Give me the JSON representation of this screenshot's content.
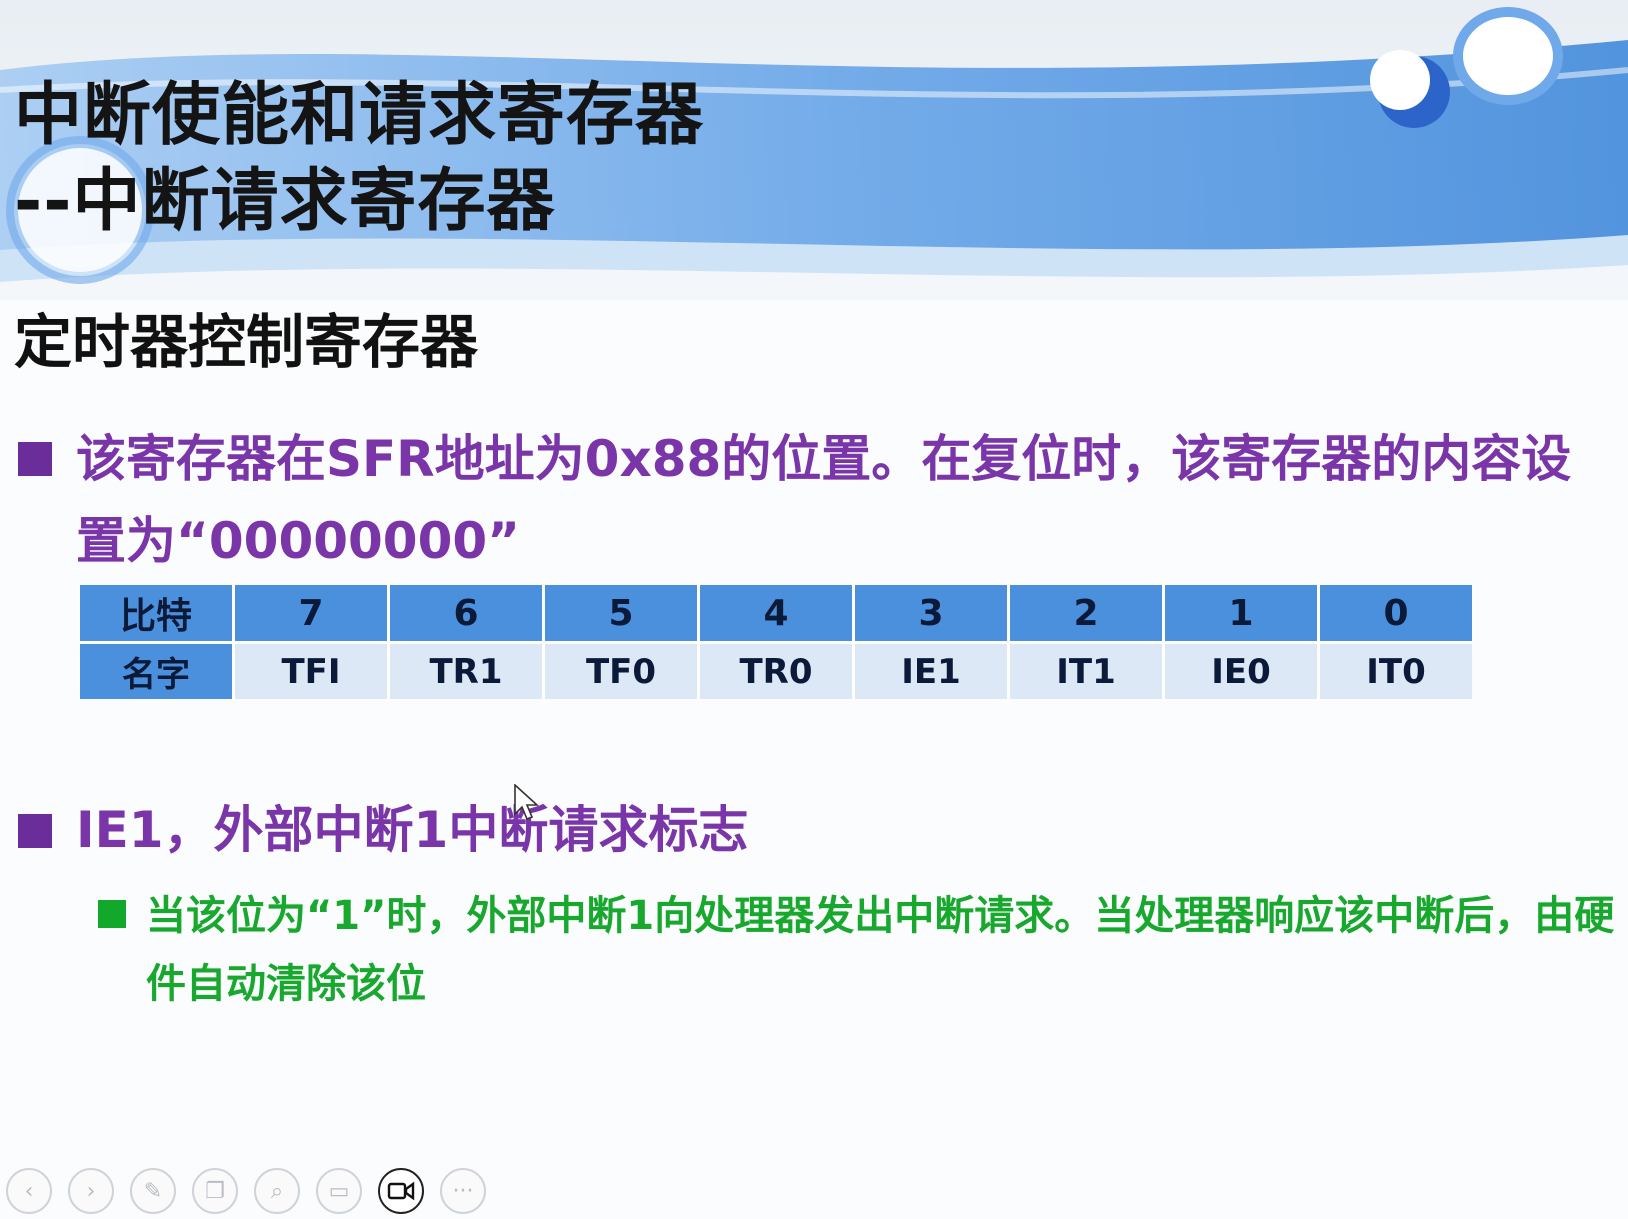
{
  "title": {
    "line1": "中断使能和请求寄存器",
    "line2": "--中断请求寄存器"
  },
  "section_heading": "定时器控制寄存器",
  "bullets": [
    {
      "text": "该寄存器在SFR地址为0x88的位置。在复位时，该寄存器的内容设置为“00000000”"
    },
    {
      "text": "IE1，外部中断1中断请求标志"
    }
  ],
  "sub_bullet": {
    "text": "当该位为“1”时，外部中断1向处理器发出中断请求。当处理器响应该中断后，由硬件自动清除该位"
  },
  "register_table": {
    "row_headers": [
      "比特",
      "名字"
    ],
    "bits": [
      "7",
      "6",
      "5",
      "4",
      "3",
      "2",
      "1",
      "0"
    ],
    "names": [
      "TFI",
      "TR1",
      "TF0",
      "TR0",
      "IE1",
      "IT1",
      "IE0",
      "IT0"
    ]
  },
  "toolbar": {
    "buttons": [
      {
        "name": "previous-slide",
        "icon": "chevron-left-icon",
        "glyph": "‹"
      },
      {
        "name": "next-slide",
        "icon": "chevron-right-icon",
        "glyph": "›"
      },
      {
        "name": "pen-tool",
        "icon": "pen-icon",
        "glyph": "✎"
      },
      {
        "name": "slide-overview",
        "icon": "slides-icon",
        "glyph": "❐"
      },
      {
        "name": "zoom",
        "icon": "magnifier-icon",
        "glyph": "⌕"
      },
      {
        "name": "subtitles",
        "icon": "subtitles-icon",
        "glyph": "▭"
      },
      {
        "name": "camera",
        "icon": "video-camera-icon",
        "glyph": "▶"
      },
      {
        "name": "more",
        "icon": "more-icon",
        "glyph": "···"
      }
    ],
    "active": "camera"
  },
  "colors": {
    "banner_blue": "#4a90dd",
    "bullet_purple": "#7a35a8",
    "sub_bullet_green": "#18a82e",
    "table_header": "#4a90dd",
    "table_cell": "#dce8f5"
  }
}
